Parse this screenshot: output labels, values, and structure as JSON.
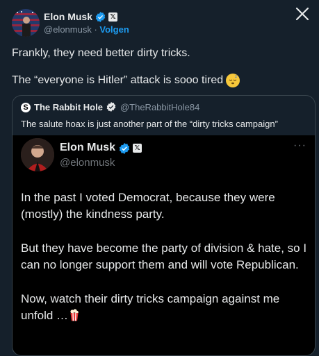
{
  "author": {
    "name": "Elon Musk",
    "handle": "@elonmusk",
    "separator": " · ",
    "follow_label": "Volgen"
  },
  "tweet": {
    "line1": "Frankly, they need better dirty tricks.",
    "line2": "The “everyone is Hitler” attack is sooo tired",
    "emoji_icon": "sleeping-face-icon"
  },
  "quote": {
    "name": "The Rabbit Hole",
    "handle": "@TheRabbitHole84",
    "logo_letter": "S",
    "text": "The salute hoax is just another part of the “dirty tricks campaign”"
  },
  "inner_post": {
    "name": "Elon Musk",
    "handle": "@elonmusk",
    "more": "···",
    "paragraphs": [
      "In the past I voted Democrat, because they were (mostly) the kindness party.",
      "But they have become the party of division & hate, so I can no longer support them and will vote Republican.",
      "Now, watch their dirty tricks campaign against me unfold …"
    ],
    "emoji_icon": "popcorn-icon"
  },
  "colors": {
    "background": "#15202b",
    "inner_background": "#000000",
    "accent": "#1d9bf0",
    "verified": "#1d9bf0"
  }
}
